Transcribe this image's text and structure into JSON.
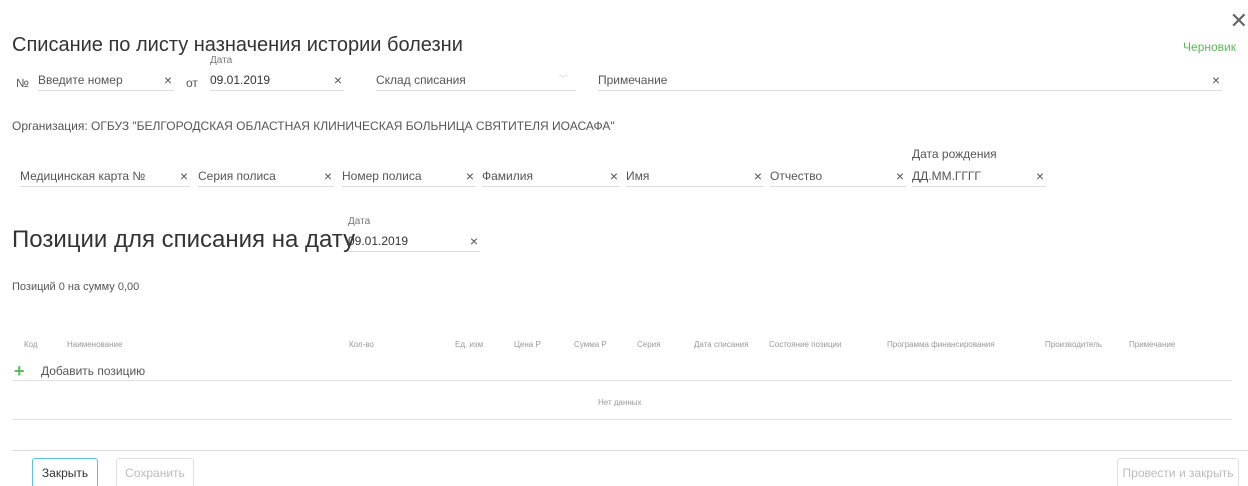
{
  "dialog": {
    "title": "Списание по листу назначения истории болезни",
    "status": "Черновик",
    "close_glyph": "✕"
  },
  "header": {
    "number_prefix": "№",
    "number_placeholder": "Введите номер",
    "from_label": "от",
    "date_label": "Дата",
    "date_value": "09.01.2019",
    "warehouse_placeholder": "Склад списания",
    "note_placeholder": "Примечание",
    "clear_glyph": "×"
  },
  "organization": "Организация: ОГБУЗ \"БЕЛГОРОДСКАЯ ОБЛАСТНАЯ КЛИНИЧЕСКАЯ БОЛЬНИЦА СВЯТИТЕЛЯ ИОАСАФА\"",
  "patient": {
    "card_label": "Медицинская карта №",
    "policy_series_label": "Серия полиса",
    "policy_number_label": "Номер полиса",
    "surname_label": "Фамилия",
    "name_label": "Имя",
    "patronymic_label": "Отчество",
    "birthdate_label": "Дата рождения",
    "birthdate_placeholder": "ДД.ММ.ГГГГ"
  },
  "positions": {
    "title": "Позиции для списания на дату",
    "date_label": "Дата",
    "date_value": "09.01.2019",
    "summary": "Позиций 0 на сумму 0,00",
    "columns": [
      "Код",
      "Наименование",
      "Кол-во",
      "Ед. изм",
      "Цена Р",
      "Сумма Р",
      "Серия",
      "Дата списания",
      "Состояние позиции",
      "Программа финансирования",
      "Производитель",
      "Примечание"
    ],
    "add_icon": "+",
    "add_label": "Добавить позицию",
    "empty_text": "Нет данных"
  },
  "footer": {
    "close_label": "Закрыть",
    "save_label": "Сохранить",
    "post_close_label": "Провести и закрыть"
  },
  "colors": {
    "accent": "#5bc0de",
    "status": "#5cb85c",
    "add_icon": "#5cb85c"
  }
}
